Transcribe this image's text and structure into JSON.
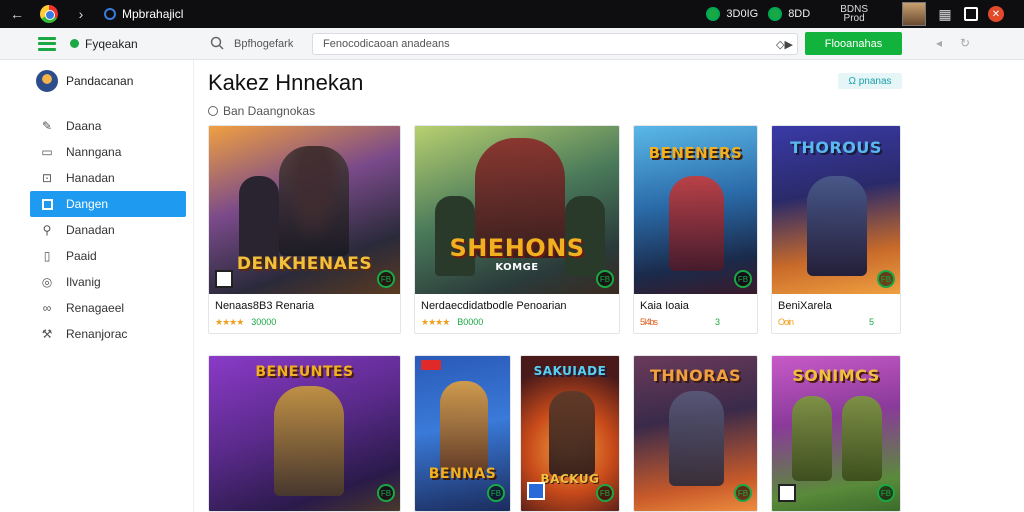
{
  "titlebar": {
    "app_title": "Mpbrahajicl",
    "stat1": "3D0IG",
    "stat2": "8DD",
    "user_line1": "BDNS",
    "user_line2": "Prod"
  },
  "toolbar": {
    "brand": "Fyqeakan",
    "search_label": "Bpfhogefark",
    "search_value": "Fenocodicaoan anadeans",
    "search_ext": "◇▶",
    "primary_button": "Flooanahas"
  },
  "sidebar": {
    "profile_name": "Pandacanan",
    "items": [
      {
        "label": "Daana",
        "icon": "pencil-icon"
      },
      {
        "label": "Nanngana",
        "icon": "image-icon"
      },
      {
        "label": "Hanadan",
        "icon": "bag-icon"
      },
      {
        "label": "Dangen",
        "icon": "square-icon",
        "active": true
      },
      {
        "label": "Danadan",
        "icon": "search-icon"
      },
      {
        "label": "Paaid",
        "icon": "device-icon"
      },
      {
        "label": "Ilvanig",
        "icon": "gamepad-icon"
      },
      {
        "label": "Renagaeel",
        "icon": "link-icon"
      },
      {
        "label": "Renanjorac",
        "icon": "tools-icon"
      }
    ]
  },
  "content": {
    "title": "Kakez Hnnekan",
    "subtitle": "Ban Daangnokas",
    "badge": "Ω pnanas"
  },
  "cards": [
    {
      "art_text": "DENKHENAES",
      "name": "Nenaas8B3 Renaria",
      "rating": "★★★★",
      "price": "30000",
      "badge": "FB"
    },
    {
      "art_text": "SHEHONS",
      "art_sub": "KOMGE",
      "name": "Nerdaecdidatbodle Penoarian",
      "rating": "★★★★",
      "price": "B0000",
      "badge": "FB"
    },
    {
      "art_text": "BENENERS",
      "name": "Kaia Ioaia",
      "rating": "5I4bs",
      "price": "3",
      "badge": "FB"
    },
    {
      "art_text": "THOROUS",
      "name": "BeniXarela",
      "rating": "Ooin",
      "price": "5",
      "badge": "FB"
    },
    {
      "art_text": "BENEUNTES",
      "badge": "FB"
    },
    {
      "art_text": "BENNAS",
      "badge": "FB"
    },
    {
      "art_text": "SAKUIADE",
      "art_sub": "BACKUG",
      "badge": "FB"
    },
    {
      "art_text": "THNORAS",
      "badge": "FB"
    },
    {
      "art_text": "SONIMCS",
      "badge": "FB"
    }
  ]
}
